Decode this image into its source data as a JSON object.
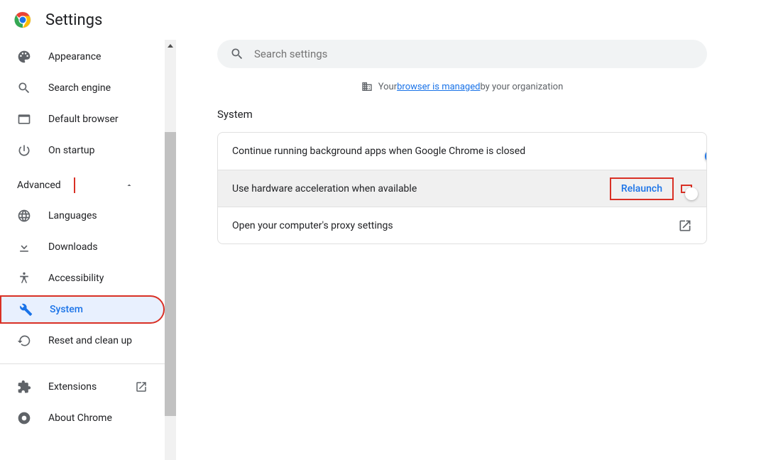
{
  "header": {
    "title": "Settings"
  },
  "search": {
    "placeholder": "Search settings"
  },
  "managed": {
    "prefix": "Your ",
    "link": "browser is managed",
    "suffix": " by your organization"
  },
  "sidebar": {
    "items": [
      {
        "label": "Appearance"
      },
      {
        "label": "Search engine"
      },
      {
        "label": "Default browser"
      },
      {
        "label": "On startup"
      }
    ],
    "advanced_label": "Advanced",
    "advanced_items": [
      {
        "label": "Languages"
      },
      {
        "label": "Downloads"
      },
      {
        "label": "Accessibility"
      },
      {
        "label": "System"
      },
      {
        "label": "Reset and clean up"
      }
    ],
    "footer": [
      {
        "label": "Extensions"
      },
      {
        "label": "About Chrome"
      }
    ]
  },
  "main": {
    "title": "System",
    "rows": [
      {
        "label": "Continue running background apps when Google Chrome is closed"
      },
      {
        "label": "Use hardware acceleration when available",
        "button": "Relaunch"
      },
      {
        "label": "Open your computer's proxy settings"
      }
    ]
  }
}
